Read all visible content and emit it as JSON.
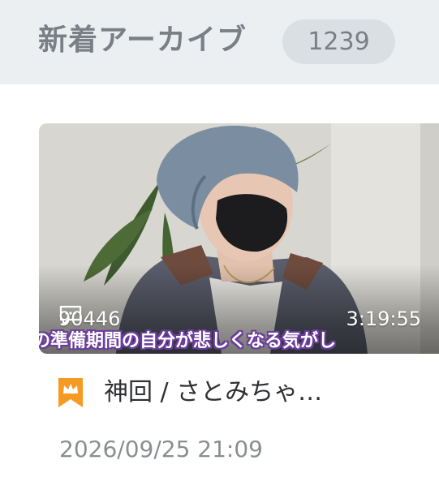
{
  "header": {
    "title": "新着アーカイブ",
    "count": "1239"
  },
  "video": {
    "comment_count": "90446",
    "duration": "3:19:55",
    "caption": "の準備期間の自分が悲しくなる気がし",
    "title": "神回 / さとみちゃ…",
    "date": "2026/09/25 21:09"
  },
  "icons": {
    "comment": "speech-bubble-icon",
    "title_badge": "crown-bookmark-icon"
  },
  "colors": {
    "header_bg": "#eceff2",
    "badge_bg": "#dadfe4",
    "muted_text": "#7a7f86",
    "bookmark_orange": "#f59a23",
    "caption_outline": "#6c3e9c"
  }
}
